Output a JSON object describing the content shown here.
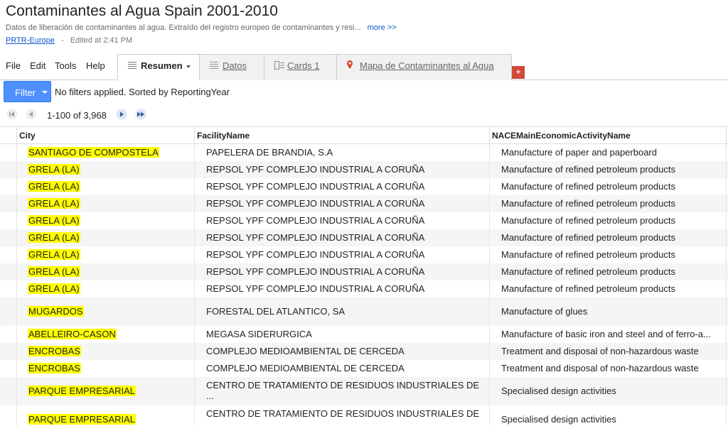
{
  "header": {
    "title": "Contaminantes al Agua Spain 2001-2010",
    "description": "Datos de liberación de contaminantes al agua. Extraído del registro europeo de contaminantes y resi...",
    "more_link": "more >>",
    "source": "PRTR-Europe",
    "separator": "-",
    "edited": "Edited at 2:41 PM"
  },
  "menu": {
    "file": "File",
    "edit": "Edit",
    "tools": "Tools",
    "help": "Help"
  },
  "tabs": [
    {
      "label": "Resumen",
      "icon": "list-icon",
      "active": true
    },
    {
      "label": "Datos",
      "icon": "table-icon",
      "active": false
    },
    {
      "label": "Cards 1",
      "icon": "cards-icon",
      "active": false
    },
    {
      "label": "Mapa de Contaminantes al Agua",
      "icon": "map-pin-icon",
      "active": false
    }
  ],
  "add_tab_label": "+",
  "filter": {
    "button_label": "Filter",
    "status": "No filters applied. Sorted by ReportingYear"
  },
  "pager": {
    "count_text": "1-100 of 3,968"
  },
  "table": {
    "columns": [
      "City",
      "FacilityName",
      "NACEMainEconomicActivityName"
    ],
    "rows": [
      {
        "city": "SANTIAGO DE COMPOSTELA",
        "facility": "PAPELERA DE BRANDIA, S.A",
        "activity": "Manufacture of paper and paperboard"
      },
      {
        "city": "GRELA (LA)",
        "facility": "REPSOL YPF COMPLEJO INDUSTRIAL A CORUÑA",
        "activity": "Manufacture of refined petroleum products"
      },
      {
        "city": "GRELA (LA)",
        "facility": "REPSOL YPF COMPLEJO INDUSTRIAL A CORUÑA",
        "activity": "Manufacture of refined petroleum products"
      },
      {
        "city": "GRELA (LA)",
        "facility": "REPSOL YPF COMPLEJO INDUSTRIAL A CORUÑA",
        "activity": "Manufacture of refined petroleum products"
      },
      {
        "city": "GRELA (LA)",
        "facility": "REPSOL YPF COMPLEJO INDUSTRIAL A CORUÑA",
        "activity": "Manufacture of refined petroleum products"
      },
      {
        "city": "GRELA (LA)",
        "facility": "REPSOL YPF COMPLEJO INDUSTRIAL A CORUÑA",
        "activity": "Manufacture of refined petroleum products"
      },
      {
        "city": "GRELA (LA)",
        "facility": "REPSOL YPF COMPLEJO INDUSTRIAL A CORUÑA",
        "activity": "Manufacture of refined petroleum products"
      },
      {
        "city": "GRELA (LA)",
        "facility": "REPSOL YPF COMPLEJO INDUSTRIAL A CORUÑA",
        "activity": "Manufacture of refined petroleum products"
      },
      {
        "city": "GRELA (LA)",
        "facility": "REPSOL YPF COMPLEJO INDUSTRIAL A CORUÑA",
        "activity": "Manufacture of refined petroleum products"
      },
      {
        "city": "MUGARDOS",
        "facility": "FORESTAL DEL ATLANTICO, SA",
        "activity": "Manufacture of glues"
      },
      {
        "city": "ABELLEIRO-CASON",
        "facility": "MEGASA SIDERURGICA",
        "activity": "Manufacture of basic iron and steel and of ferro-a..."
      },
      {
        "city": "ENCROBAS",
        "facility": "COMPLEJO MEDIOAMBIENTAL DE CERCEDA",
        "activity": "Treatment and disposal of non-hazardous waste"
      },
      {
        "city": "ENCROBAS",
        "facility": "COMPLEJO MEDIOAMBIENTAL DE CERCEDA",
        "activity": "Treatment and disposal of non-hazardous waste"
      },
      {
        "city": "PARQUE EMPRESARIAL",
        "facility": "CENTRO DE TRATAMIENTO DE RESIDUOS INDUSTRIALES DE ...",
        "activity": "Specialised design activities"
      },
      {
        "city": "PARQUE EMPRESARIAL",
        "facility": "CENTRO DE TRATAMIENTO DE RESIDUOS INDUSTRIALES DE ...",
        "activity": "Specialised design activities"
      }
    ]
  },
  "colors": {
    "highlight": "#ffff00",
    "filter_button": "#4d90fe",
    "link": "#1155cc",
    "add_tab": "#d14836"
  }
}
